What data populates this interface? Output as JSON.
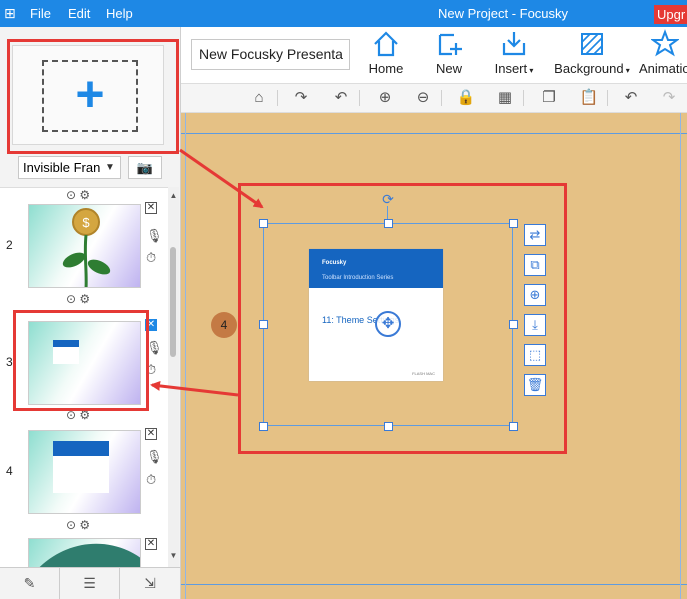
{
  "titlebar": {
    "app_icon": "app-logo-icon",
    "menu": [
      "File",
      "Edit",
      "Help"
    ],
    "title": "New Project - Focusky",
    "upgrade_label": "Upgr"
  },
  "left_panel": {
    "add_frame_icon": "plus-icon",
    "frame_type": "Invisible Fran",
    "camera_icon": "camera-icon",
    "thumbnails": [
      {
        "number": "2"
      },
      {
        "number": "3"
      },
      {
        "number": "4"
      }
    ],
    "bottom_icons": [
      "edit-icon",
      "slide-list-icon",
      "export-icon"
    ]
  },
  "ribbon": {
    "presentation_title": "New Focusky Presenta",
    "buttons": [
      {
        "label": "Home",
        "icon": "home-icon"
      },
      {
        "label": "New",
        "icon": "new-frame-icon"
      },
      {
        "label": "Insert",
        "icon": "insert-icon",
        "has_dropdown": true
      },
      {
        "label": "Background",
        "icon": "background-icon",
        "has_dropdown": true
      },
      {
        "label": "Animation",
        "icon": "animation-icon"
      }
    ]
  },
  "toolbar2": {
    "icons": [
      "home-icon",
      "redo-rotate-icon",
      "undo-rotate-icon",
      "zoom-in-icon",
      "zoom-out-icon",
      "lock-icon",
      "grid-icon",
      "copy-icon",
      "paste-icon",
      "undo-icon",
      "redo-icon"
    ]
  },
  "canvas": {
    "background_color": "#e5c185",
    "frame_number": "4",
    "slide": {
      "logo_text": "Focusky",
      "subtitle": "Toolbar Introduction Series",
      "title": "11: Theme Settings",
      "footer": "FLASH MAC"
    },
    "side_tools": [
      "swap-icon",
      "replace-icon",
      "add-circle-icon",
      "import-icon",
      "select-icon",
      "delete-icon"
    ]
  },
  "colors": {
    "titlebar": "#1e88e5",
    "highlight": "#e53935",
    "selection": "#3a7ad6"
  }
}
